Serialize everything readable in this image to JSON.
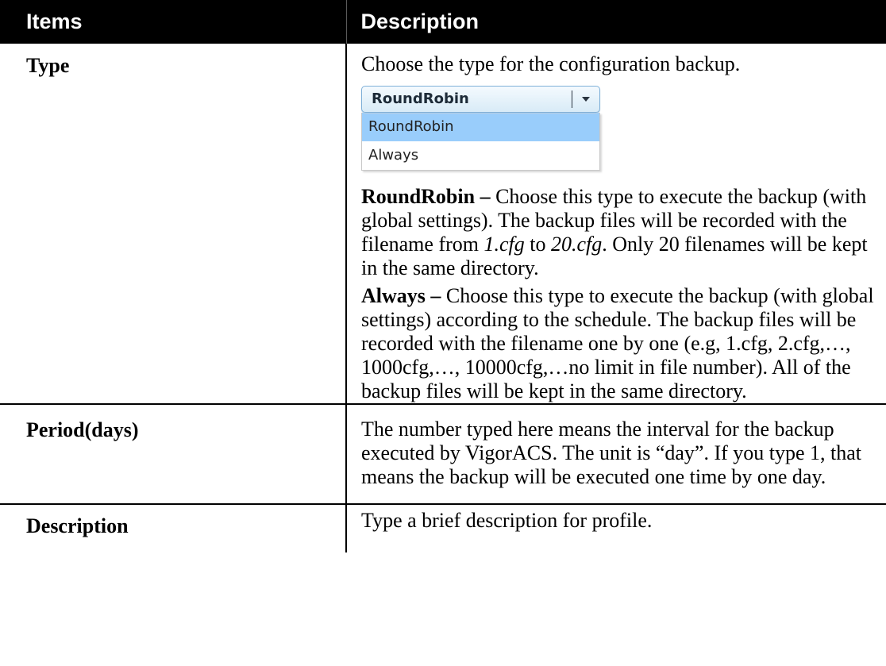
{
  "header": {
    "col1": "Items",
    "col2": "Description"
  },
  "rows": {
    "type": {
      "label": "Type",
      "intro": "Choose the type for the configuration backup.",
      "dropdown": {
        "selected": "RoundRobin",
        "options": [
          "RoundRobin",
          "Always"
        ],
        "highlighted_option": "RoundRobin"
      },
      "roundrobin": {
        "term": "RoundRobin –",
        "text_a": " Choose this type to execute the backup (with global settings). The backup files will be recorded with the filename from ",
        "file_from": "1.cfg",
        "text_b": " to ",
        "file_to": "20.cfg",
        "text_c": ". Only 20 filenames will be kept in the same directory."
      },
      "always": {
        "term": "Always –",
        "text": " Choose this type to execute the backup (with global settings) according to the schedule. The backup files will be recorded with the filename one by one (e.g, 1.cfg, 2.cfg,…, 1000cfg,…, 10000cfg,…no limit in file number). All of the backup files will be kept in the same directory."
      }
    },
    "period": {
      "label": "Period(days)",
      "text": "The number typed here means the interval for the backup executed by VigorACS. The unit is “day”. If you type 1, that means the backup will be executed one time by one day."
    },
    "description": {
      "label": "Description",
      "text": "Type a brief description for profile."
    }
  }
}
